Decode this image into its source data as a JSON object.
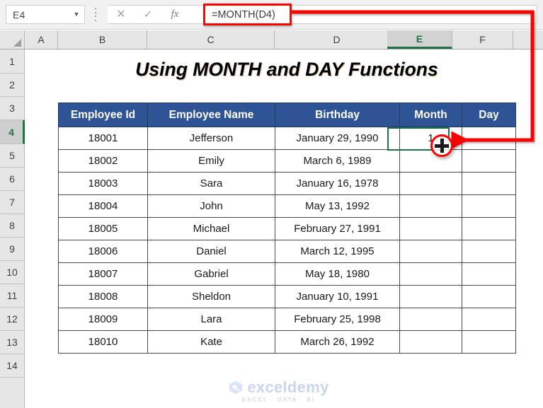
{
  "formula_bar": {
    "name_box_value": "E4",
    "name_box_caret": "▼",
    "cancel_icon": "✕",
    "confirm_icon": "✓",
    "function_icon": "fx",
    "formula_value": "=MONTH(D4)",
    "highlight_color": "#ff0000"
  },
  "columns": [
    {
      "label": "A",
      "selected": false
    },
    {
      "label": "B",
      "selected": false
    },
    {
      "label": "C",
      "selected": false
    },
    {
      "label": "D",
      "selected": false
    },
    {
      "label": "E",
      "selected": true
    },
    {
      "label": "F",
      "selected": false
    }
  ],
  "rows": [
    {
      "label": "1",
      "selected": false
    },
    {
      "label": "2",
      "selected": false
    },
    {
      "label": "3",
      "selected": false
    },
    {
      "label": "4",
      "selected": true
    },
    {
      "label": "5",
      "selected": false
    },
    {
      "label": "6",
      "selected": false
    },
    {
      "label": "7",
      "selected": false
    },
    {
      "label": "8",
      "selected": false
    },
    {
      "label": "9",
      "selected": false
    },
    {
      "label": "10",
      "selected": false
    },
    {
      "label": "11",
      "selected": false
    },
    {
      "label": "12",
      "selected": false
    },
    {
      "label": "13",
      "selected": false
    },
    {
      "label": "14",
      "selected": false
    }
  ],
  "sheet": {
    "title": "Using MONTH and DAY Functions",
    "header_fill": "#2f5496",
    "selection_color": "#217346",
    "table": {
      "headers": [
        "Employee Id",
        "Employee Name",
        "Birthday",
        "Month",
        "Day"
      ],
      "rows": [
        {
          "employee_id": "18001",
          "employee_name": "Jefferson",
          "birthday": "January 29, 1990",
          "month": "1",
          "day": ""
        },
        {
          "employee_id": "18002",
          "employee_name": "Emily",
          "birthday": "March 6, 1989",
          "month": "",
          "day": ""
        },
        {
          "employee_id": "18003",
          "employee_name": "Sara",
          "birthday": "January 16, 1978",
          "month": "",
          "day": ""
        },
        {
          "employee_id": "18004",
          "employee_name": "John",
          "birthday": "May 13, 1992",
          "month": "",
          "day": ""
        },
        {
          "employee_id": "18005",
          "employee_name": "Michael",
          "birthday": "February 27, 1991",
          "month": "",
          "day": ""
        },
        {
          "employee_id": "18006",
          "employee_name": "Daniel",
          "birthday": "March 12, 1995",
          "month": "",
          "day": ""
        },
        {
          "employee_id": "18007",
          "employee_name": "Gabriel",
          "birthday": "May 18, 1980",
          "month": "",
          "day": ""
        },
        {
          "employee_id": "18008",
          "employee_name": "Sheldon",
          "birthday": "January 10, 1991",
          "month": "",
          "day": ""
        },
        {
          "employee_id": "18009",
          "employee_name": "Lara",
          "birthday": "February 25, 1998",
          "month": "",
          "day": ""
        },
        {
          "employee_id": "18010",
          "employee_name": "Kate",
          "birthday": "March 26, 1992",
          "month": "",
          "day": ""
        }
      ]
    }
  },
  "annotations": {
    "color": "#ff0000",
    "formula_to_cell_arrow": "callout pointing from the formula bar to cell E4",
    "fill_down_arrow": "drag fill handle downward through the Month column",
    "fill_handle_cursor": "fill-handle-crosshair"
  },
  "watermark": {
    "brand": "exceldemy",
    "tagline": "EXCEL · DATA · BI"
  }
}
